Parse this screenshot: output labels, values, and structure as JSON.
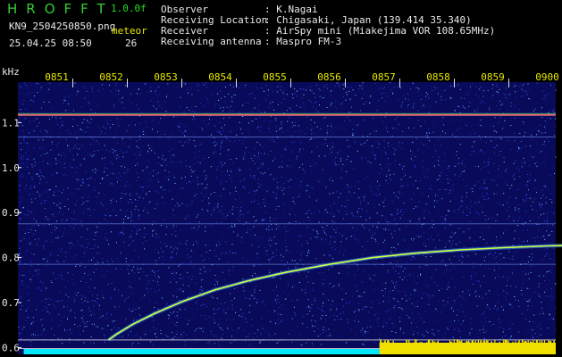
{
  "header": {
    "logo": "HROFFT",
    "version": "1.0.0f",
    "filename": "KN9_2504250850.png",
    "datetime": "25.04.25 08:50",
    "meteor_label": "meteor",
    "meteor_count": "26",
    "info": [
      {
        "label": "Observer",
        "value": ": K.Nagai"
      },
      {
        "label": "Receiving Location",
        "value": ": Chigasaki, Japan (139.414 35.340)"
      },
      {
        "label": "Receiver",
        "value": ": AirSpy mini (Miakejima VOR 108.65MHz)"
      },
      {
        "label": "Receiving antenna",
        "value": ": Maspro FM-3"
      }
    ]
  },
  "colors": {
    "background": "#000000",
    "plot_background": "#0a0a5a",
    "time_label": "#e8e800",
    "freq_label": "#e8e8e8",
    "trace": "#d8ff40",
    "carrier": "#ff7070",
    "bar_yellow": "#f0e000",
    "bar_cyan": "#00e8ff"
  },
  "chart_data": {
    "type": "heatmap",
    "ylabel": "kHz",
    "x_ticks": [
      "0851",
      "0852",
      "0853",
      "0854",
      "0855",
      "0856",
      "0857",
      "0858",
      "0859",
      "0900"
    ],
    "y_ticks": [
      1.1,
      1.0,
      0.9,
      0.8,
      0.7,
      0.6
    ],
    "xlim": [
      0,
      10
    ],
    "ylim": [
      0.585,
      1.19
    ],
    "horizontal_lines": [
      {
        "freq": 1.117,
        "kind": "carrier"
      },
      {
        "freq": 1.068,
        "kind": "faint"
      },
      {
        "freq": 0.875,
        "kind": "faint"
      },
      {
        "freq": 0.785,
        "kind": "faint"
      },
      {
        "freq": 0.617,
        "kind": "marker"
      },
      {
        "freq": 0.598,
        "kind": "marker"
      }
    ],
    "trace": {
      "x": [
        0.95,
        1.1,
        1.4,
        1.8,
        2.3,
        2.9,
        3.5,
        4.2,
        5.0,
        5.8,
        6.6,
        7.4,
        8.2,
        9.0,
        9.8
      ],
      "y": [
        0.617,
        0.63,
        0.652,
        0.676,
        0.702,
        0.728,
        0.748,
        0.767,
        0.785,
        0.8,
        0.81,
        0.817,
        0.822,
        0.826,
        0.828
      ]
    },
    "activity_bar": {
      "x_start": 0.05,
      "split_at": 5.92,
      "x_end": 9.98
    }
  }
}
